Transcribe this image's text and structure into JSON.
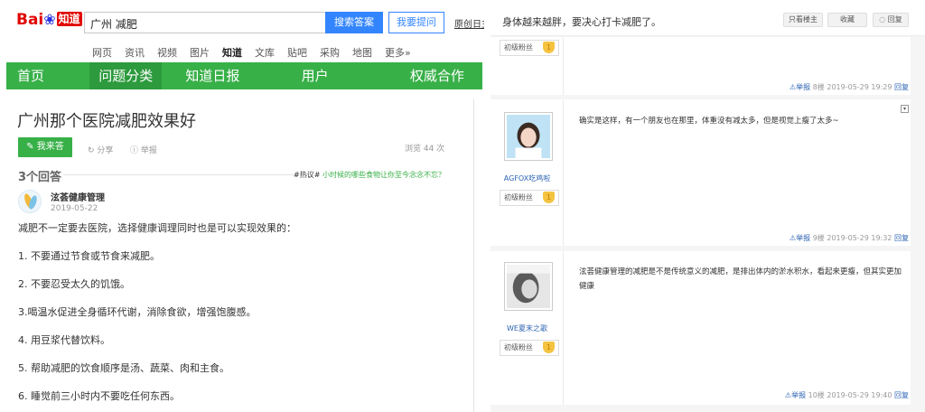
{
  "logo": {
    "brand": "Bai",
    "paw": "❀",
    "product": "知道"
  },
  "search": {
    "query": "广州 减肥",
    "search_btn": "搜索答案",
    "ask_btn": "我要提问",
    "help_link": "原创日主"
  },
  "product_nav": [
    "网页",
    "资讯",
    "视频",
    "图片",
    "知道",
    "文库",
    "贴吧",
    "采购",
    "地图",
    "更多»"
  ],
  "product_nav_active": "知道",
  "green_nav": [
    "首页",
    "问题分类",
    "知道日报",
    "用户",
    "权威合作"
  ],
  "question": {
    "title": "广州那个医院减肥效果好",
    "answer_btn": "我来答",
    "share": "分享",
    "report": "举报",
    "views": "浏览 44 次"
  },
  "answers": {
    "count_label": "3个回答",
    "hot_prefix": "#热议#",
    "hot_link": "小时候的哪些食物让你至今念念不忘？"
  },
  "best_answer": {
    "author": "泫荟健康管理",
    "date": "2019-05-22",
    "lines": [
      "减肥不一定要去医院，选择健康调理同时也是可以实现效果的：",
      "1. 不要通过节食或节食来减肥。",
      "2. 不要忍受太久的饥饿。",
      "3.喝温水促进全身循环代谢，消除食欲，增强饱腹感。",
      "4. 用豆浆代替饮料。",
      "5. 帮助减肥的饮食顺序是汤、蔬菜、肉和主食。",
      "6. 睡觉前三小时内不要吃任何东西。"
    ]
  },
  "thread": {
    "title": "身体越来越胖，要决心打卡减肥了。",
    "only_op": "只看楼主",
    "collect": "收藏",
    "reply": "回复",
    "floors": [
      {
        "user": "",
        "rank": "初级粉丝",
        "text": "",
        "report": "举报",
        "floor": "8楼",
        "time": "2019-05-29 19:29",
        "reply": "回复"
      },
      {
        "user": "AGFOX吃鸡啦",
        "rank": "初级粉丝",
        "text": "确实是这样，有一个朋友也在那里，体重没有减太多，但是视觉上瘦了太多~",
        "report": "举报",
        "floor": "9楼",
        "time": "2019-05-29 19:32",
        "reply": "回复"
      },
      {
        "user": "WE夏末之歌",
        "rank": "初级粉丝",
        "text": "泫荟健康管理的减肥是不是传统意义的减肥，是排出体内的淤水积水，看起来更瘦，但其实更加健康",
        "report": "举报",
        "floor": "10楼",
        "time": "2019-05-29 19:40",
        "reply": "回复"
      }
    ]
  },
  "colors": {
    "green": "#38b048",
    "blue": "#3385ff",
    "red": "#e10602"
  }
}
